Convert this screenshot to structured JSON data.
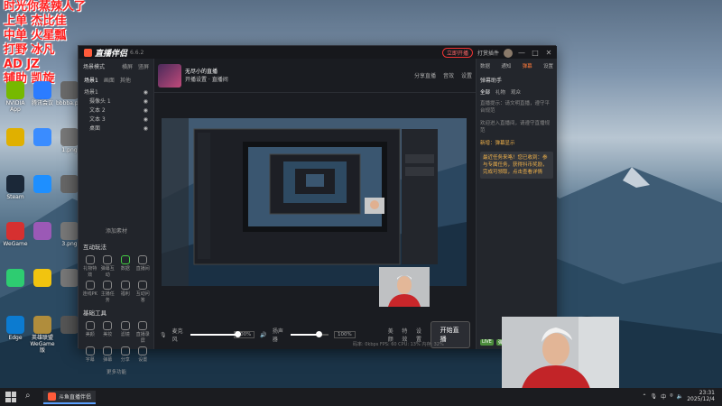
{
  "overlay": {
    "lines": [
      "时光你蒸辣人了",
      "上单 杰比佳",
      "中单 火星瓢",
      "打野 冰凡",
      "AD JZ",
      "辅助 凯旋"
    ]
  },
  "desktop": {
    "icons": [
      {
        "label": "NVIDIA App",
        "color": "#76b900"
      },
      {
        "label": "腾讯会议",
        "color": "#2b7cff"
      },
      {
        "label": "bbbba.png",
        "color": "#6a6a6a"
      },
      {
        "label": "",
        "color": "#e0b000"
      },
      {
        "label": "",
        "color": "#3a8cff"
      },
      {
        "label": "1.png",
        "color": "#777"
      },
      {
        "label": "Steam",
        "color": "#1b2838"
      },
      {
        "label": "",
        "color": "#1e8fff"
      },
      {
        "label": "",
        "color": "#666"
      },
      {
        "label": "WeGame",
        "color": "#d63030"
      },
      {
        "label": "",
        "color": "#9b59b6"
      },
      {
        "label": "3.png",
        "color": "#777"
      },
      {
        "label": "",
        "color": "#2ecc71"
      },
      {
        "label": "",
        "color": "#f1c40f"
      },
      {
        "label": "",
        "color": "#777"
      },
      {
        "label": "Edge",
        "color": "#0c7bd0"
      },
      {
        "label": "英雄联盟WeGame版",
        "color": "#b08d3c"
      },
      {
        "label": "",
        "color": "#555"
      }
    ]
  },
  "app": {
    "title": "直播伴侣",
    "version": "6.6.2",
    "live_pill": "立即开播",
    "top_link": "打赏插件",
    "window_controls": [
      "—",
      "□",
      "✕"
    ],
    "left_panel": {
      "header": "场景模式",
      "header_tabs": [
        "横屏",
        "竖屏"
      ],
      "tabs": [
        "场景1",
        "画面",
        "其他"
      ],
      "scenes": [
        {
          "name": "场景1",
          "sub": false
        },
        {
          "name": "摄像头 1",
          "sub": true
        },
        {
          "name": "文本 2",
          "sub": true
        },
        {
          "name": "文本 3",
          "sub": true
        },
        {
          "name": "桌面",
          "sub": true
        }
      ],
      "add_source": "添加素材",
      "interact_title": "互动玩法",
      "interact_items": [
        "礼物特效",
        "弹幕互动",
        "数据",
        "直播间",
        "连线PK",
        "主播任务",
        "福利",
        "互动问答"
      ],
      "tools_title": "基础工具",
      "tools_items": [
        "美颜",
        "美妆",
        "滤镜",
        "直播录屏",
        "字幕",
        "弹幕",
        "分享",
        "设置"
      ],
      "more": "更多功能"
    },
    "room": {
      "title": "无尽小的直播",
      "subtitle": "开播设置 · 直播间",
      "right_items": [
        "分享直播",
        "音效",
        "设置"
      ]
    },
    "controls": {
      "mic_label": "麦克风",
      "mic_value": "100%",
      "speaker_label": "扬声器",
      "speaker_value": "100%",
      "mic_level": 1.0,
      "speaker_level": 0.6,
      "icons": [
        "美颜",
        "特效",
        "设置"
      ],
      "start_button": "开始直播"
    },
    "status": "码率: 0kbps  FPS: 60  CPU: 13%  内存: 32%",
    "right_panel": {
      "tabs": [
        "数据",
        "通知",
        "弹幕",
        "设置"
      ],
      "title": "弹幕助手",
      "sub_tabs": [
        "全部",
        "礼物",
        "观众"
      ],
      "messages": [
        {
          "text": "直播提示：请文明直播，遵守平台规范",
          "hl": false
        },
        {
          "text": "欢迎进入直播间，请遵守直播规范",
          "hl": false
        },
        {
          "text": "新增：弹幕显示",
          "hl": true
        }
      ],
      "bubble": "最近任务来咯！您已收到：参与专属任务，获得抖币奖励，完成可领取，点击查看详情",
      "bottom_badges": [
        "LIVE",
        "弹幕"
      ]
    }
  },
  "taskbar": {
    "task_label": "斗鱼直播伴侣",
    "tray_label": "中",
    "time": "23:31",
    "date": "2025/12/4"
  },
  "colors": {
    "accent": "#ff5b3a",
    "overlay_text": "#ff2020",
    "app_bg": "#1d1f25"
  }
}
